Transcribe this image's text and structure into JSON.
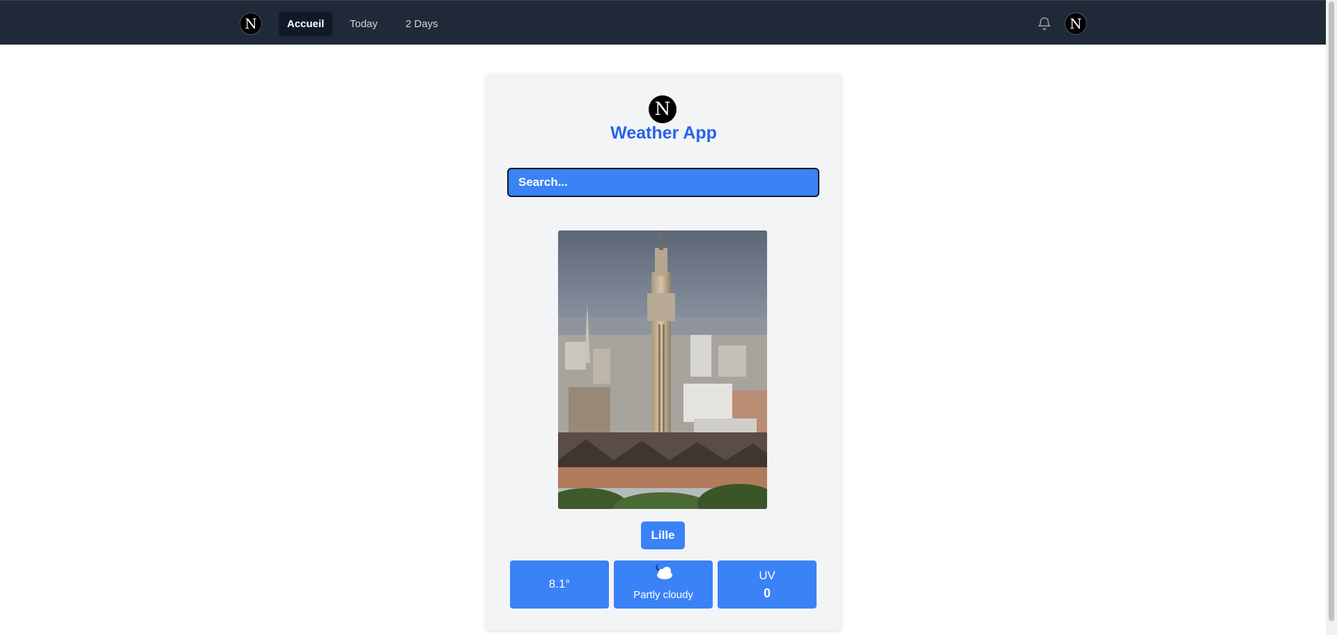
{
  "nav": {
    "brand_logo_letter": "N",
    "links": [
      {
        "label": "Accueil",
        "active": true
      },
      {
        "label": "Today",
        "active": false
      },
      {
        "label": "2 Days",
        "active": false
      }
    ],
    "notifications_icon": "bell-icon",
    "avatar_letter": "N"
  },
  "main": {
    "logo_letter": "N",
    "title": "Weather App",
    "search": {
      "placeholder": "Search...",
      "value": ""
    },
    "city_image_icon": "city-photo-image",
    "city": "Lille",
    "weather": {
      "temperature": "8.1°",
      "condition": "Partly cloudy",
      "condition_icon": "partly-cloudy-night-icon",
      "uv_label": "UV",
      "uv_value": "0"
    }
  },
  "colors": {
    "navbar": "#1f2937",
    "accent": "#3b82f6",
    "title": "#2563eb",
    "card": "#f3f4f6"
  }
}
